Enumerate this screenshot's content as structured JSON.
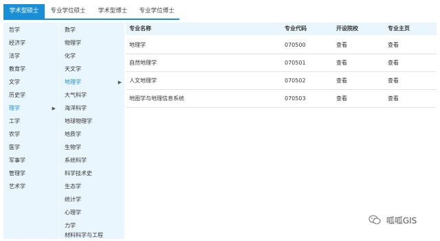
{
  "tabs": [
    {
      "label": "学术型硕士",
      "active": true
    },
    {
      "label": "专业学位硕士",
      "active": false
    },
    {
      "label": "学术型博士",
      "active": false
    },
    {
      "label": "专业学位博士",
      "active": false
    }
  ],
  "disciplines": [
    "哲学",
    "经济学",
    "法学",
    "教育学",
    "文学",
    "历史学",
    "理学",
    "工学",
    "农学",
    "医学",
    "军事学",
    "管理学",
    "艺术学"
  ],
  "disciplines_active": "理学",
  "subjects": [
    "数学",
    "物理学",
    "化学",
    "天文学",
    "地理学",
    "大气科学",
    "海洋科学",
    "地球物理学",
    "地质学",
    "生物学",
    "系统科学",
    "科学技术史",
    "生态学",
    "统计学",
    "心理学",
    "力学",
    "材料科学与工程"
  ],
  "subjects_active": "地理学",
  "table": {
    "headers": [
      "专业名称",
      "专业代码",
      "开设院校",
      "专业主页"
    ],
    "rows": [
      [
        "地理学",
        "070500",
        "查看",
        "查看"
      ],
      [
        "自然地理学",
        "070501",
        "查看",
        "查看"
      ],
      [
        "人文地理学",
        "070502",
        "查看",
        "查看"
      ],
      [
        "地图学与地理信息系统",
        "070503",
        "查看",
        "查看"
      ]
    ]
  },
  "watermark": {
    "text": "呱呱GIS",
    "icon": "wechat-icon"
  },
  "colors": {
    "accent": "#1a8fd8",
    "panel_bg": "#eaf6fd"
  }
}
